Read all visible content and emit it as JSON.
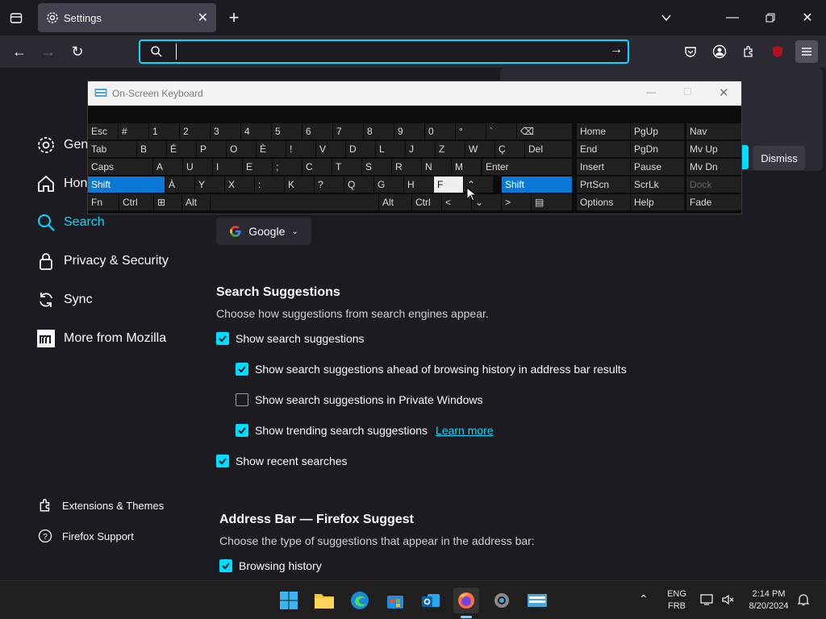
{
  "tab": {
    "title": "Settings"
  },
  "urlbar": {
    "value": "",
    "placeholder": ""
  },
  "sidebar": {
    "items": [
      {
        "label": "Gen"
      },
      {
        "label": "Hon"
      },
      {
        "label": "Search"
      },
      {
        "label": "Privacy & Security"
      },
      {
        "label": "Sync"
      },
      {
        "label": "More from Mozilla"
      }
    ],
    "footer": [
      {
        "label": "Extensions & Themes"
      },
      {
        "label": "Firefox Support"
      }
    ]
  },
  "search": {
    "engine": "Google",
    "suggestions_title": "Search Suggestions",
    "suggestions_desc": "Choose how suggestions from search engines appear.",
    "options": [
      {
        "label": "Show search suggestions",
        "checked": true
      },
      {
        "label": "Show search suggestions ahead of browsing history in address bar results",
        "checked": true
      },
      {
        "label": "Show search suggestions in Private Windows",
        "checked": false
      },
      {
        "label": "Show trending search suggestions",
        "checked": true,
        "link": "Learn more"
      },
      {
        "label": "Show recent searches",
        "checked": true
      }
    ],
    "addressbar_title": "Address Bar — Firefox Suggest",
    "addressbar_desc": "Choose the type of suggestions that appear in the address bar:",
    "browsing_history": "Browsing history"
  },
  "notification": {
    "dismiss": "Dismiss"
  },
  "osk": {
    "title": "On-Screen Keyboard"
  },
  "taskbar": {
    "lang1": "ENG",
    "lang2": "FRB",
    "time": "2:14 PM",
    "date": "8/20/2024"
  },
  "colors": {
    "accent": "#00ddff",
    "osk_highlight": "#0a78d7"
  }
}
